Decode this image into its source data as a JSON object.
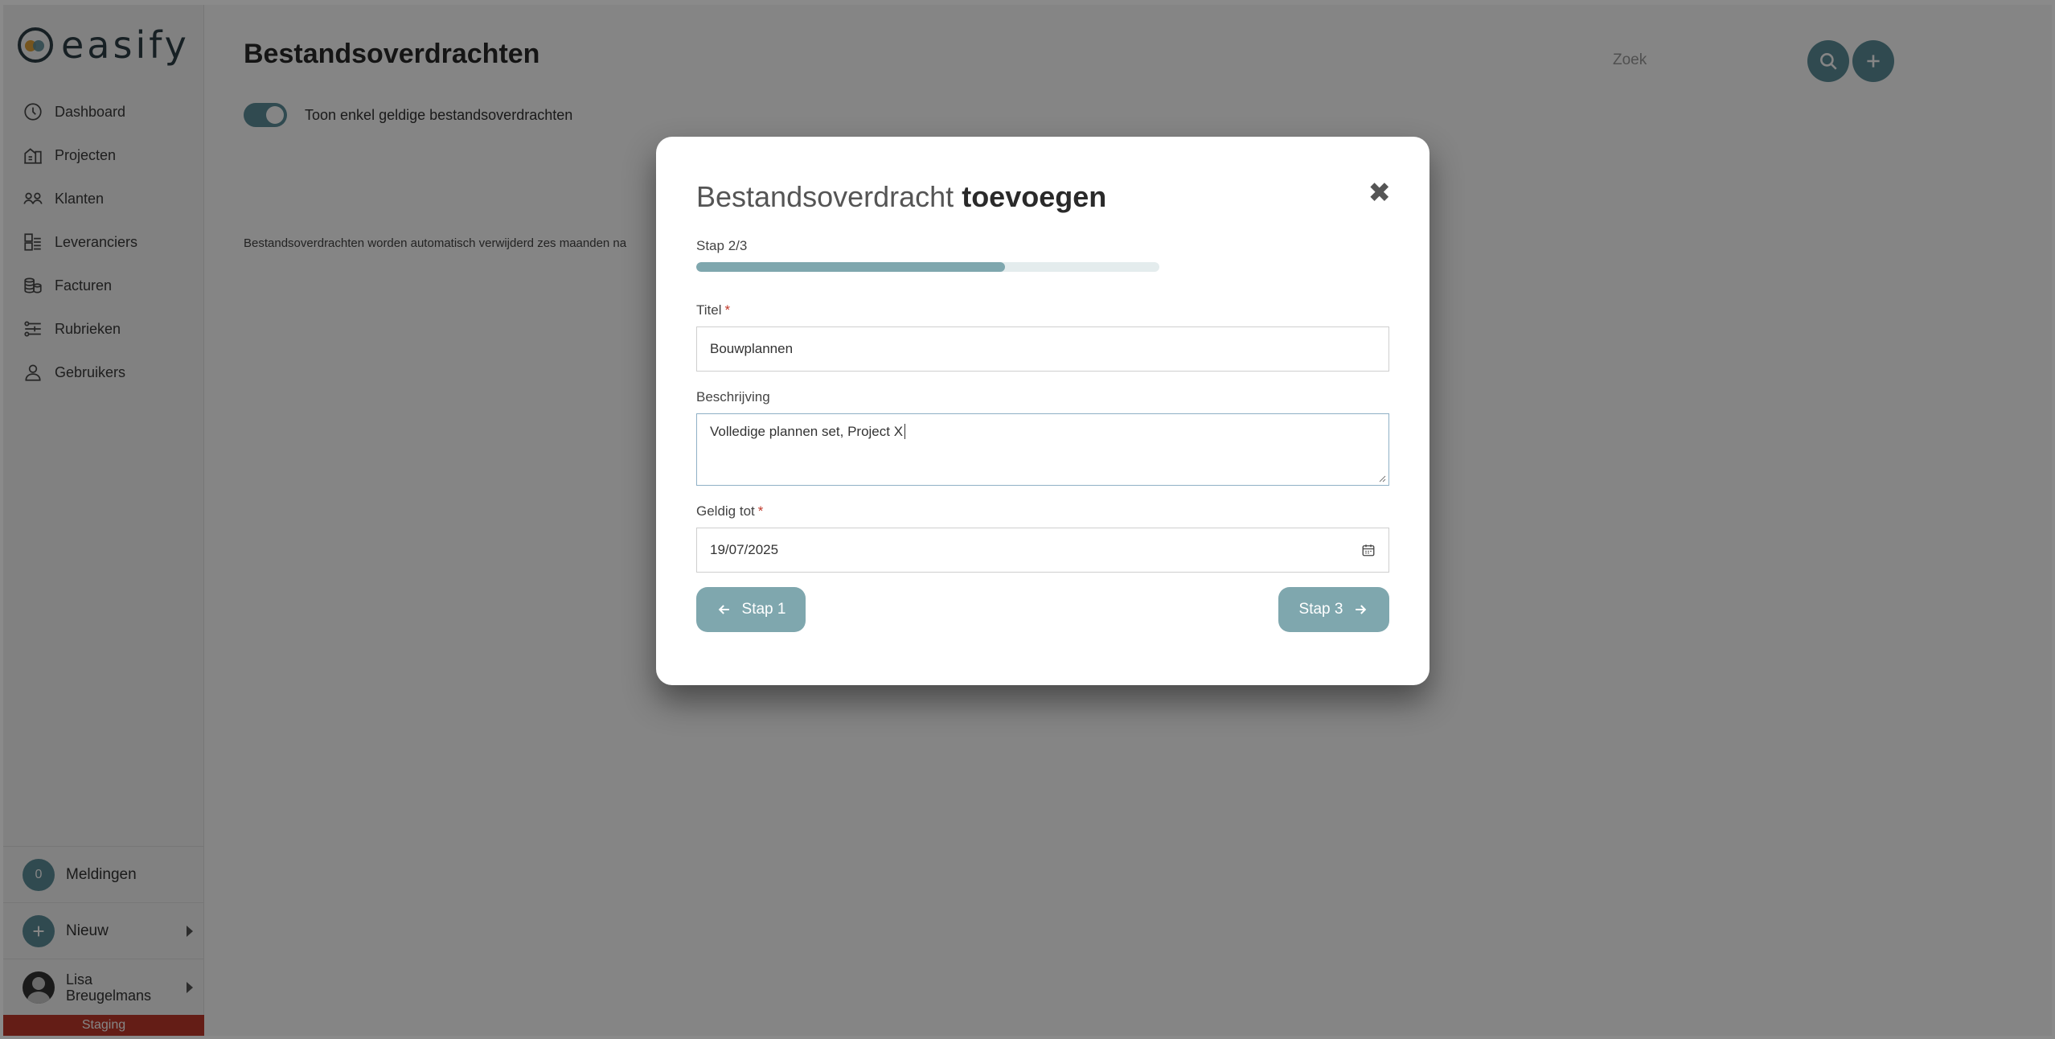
{
  "app": {
    "logo_text": "easify"
  },
  "sidebar": {
    "items": [
      {
        "label": "Dashboard",
        "icon": "dashboard-icon"
      },
      {
        "label": "Projecten",
        "icon": "buildings-icon"
      },
      {
        "label": "Klanten",
        "icon": "people-icon"
      },
      {
        "label": "Leveranciers",
        "icon": "supplier-icon"
      },
      {
        "label": "Facturen",
        "icon": "coins-icon"
      },
      {
        "label": "Rubrieken",
        "icon": "rubrics-icon"
      },
      {
        "label": "Gebruikers",
        "icon": "user-icon"
      }
    ],
    "notifications": {
      "count": "0",
      "label": "Meldingen"
    },
    "new": {
      "label": "Nieuw"
    },
    "user": {
      "first": "Lisa",
      "last": "Breugelmans"
    },
    "environment": "Staging"
  },
  "main": {
    "title": "Bestandsoverdrachten",
    "search_label": "Zoek",
    "toggle_label": "Toon enkel geldige bestandsoverdrachten",
    "info_text": "Bestandsoverdrachten worden automatisch verwijderd zes maanden na"
  },
  "modal": {
    "title_light": "Bestandsoverdracht",
    "title_bold": "toevoegen",
    "step_label": "Stap 2/3",
    "progress": 0.667,
    "fields": {
      "titel_label": "Titel",
      "titel_value": "Bouwplannen",
      "beschrijving_label": "Beschrijving",
      "beschrijving_value": "Volledige plannen set, Project X",
      "geldig_label": "Geldig tot",
      "geldig_value": "19/07/2025"
    },
    "required_mark": "*",
    "back_button": "Stap 1",
    "next_button": "Stap 3",
    "close_symbol": "✖"
  },
  "colors": {
    "accent": "#5d8f9a",
    "button": "#7fa7ae",
    "staging": "#c0392b"
  }
}
